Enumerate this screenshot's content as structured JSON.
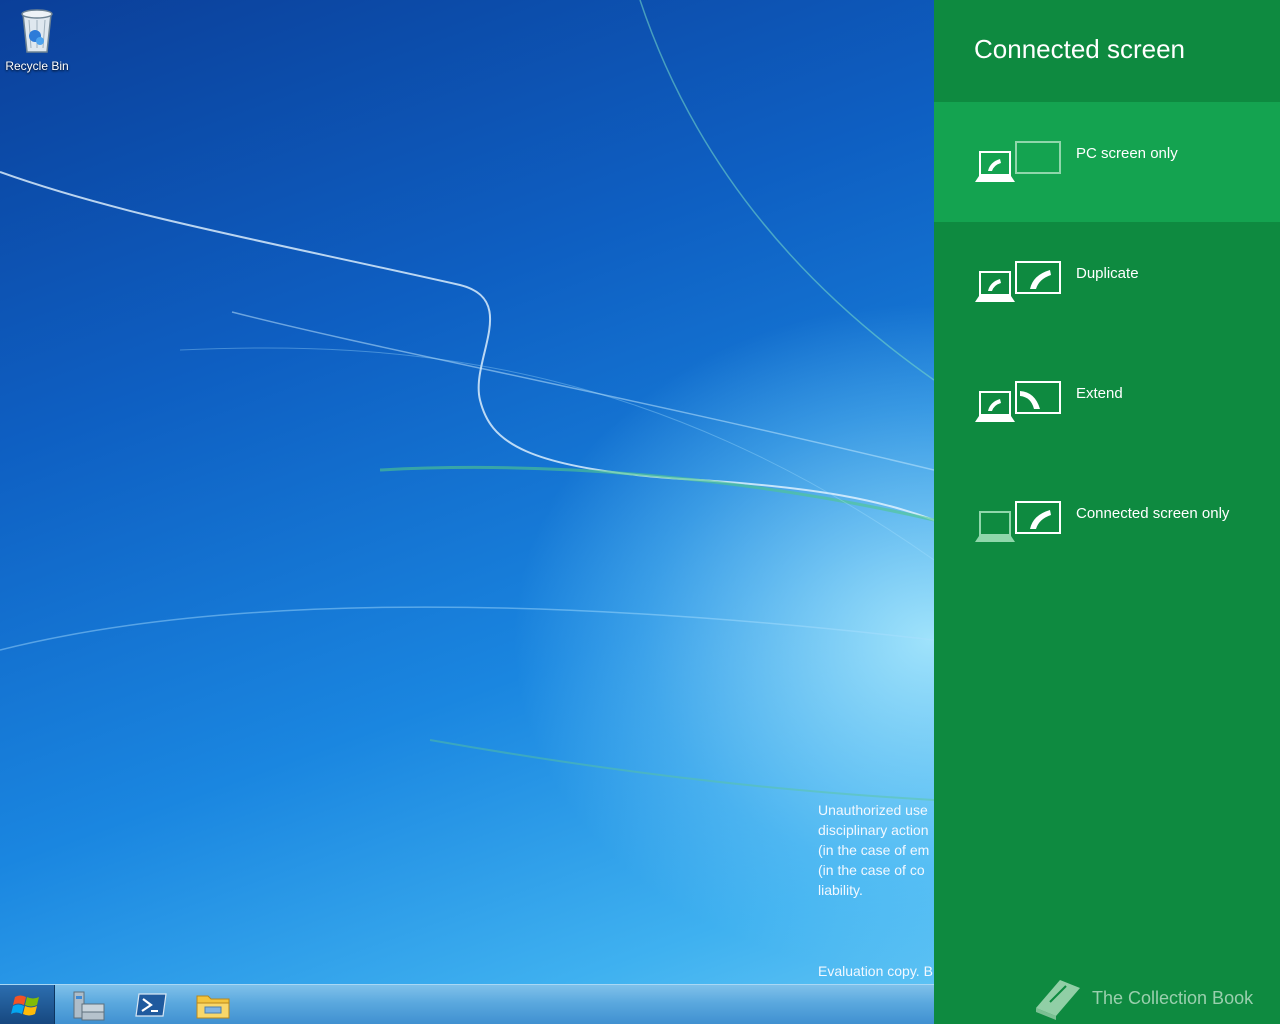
{
  "desktop": {
    "recycle_bin_label": "Recycle Bin",
    "legal_lines": [
      "Unauthorized use",
      "disciplinary action",
      "(in the case of em",
      "(in the case of co",
      "liability."
    ],
    "evaluation_text": "Evaluation copy. B"
  },
  "taskbar": {
    "items": [
      {
        "icon": "windows-logo-icon"
      },
      {
        "icon": "server-manager-icon"
      },
      {
        "icon": "powershell-icon"
      },
      {
        "icon": "file-explorer-icon"
      }
    ]
  },
  "charm": {
    "title": "Connected screen",
    "background": "#0e8a40",
    "selected_background": "#14a350",
    "options": [
      {
        "label": "PC screen only",
        "icon": "pc-screen-only-icon",
        "selected": true
      },
      {
        "label": "Duplicate",
        "icon": "duplicate-icon",
        "selected": false
      },
      {
        "label": "Extend",
        "icon": "extend-icon",
        "selected": false
      },
      {
        "label": "Connected screen only",
        "icon": "connected-screen-only-icon",
        "selected": false
      }
    ]
  },
  "watermark": {
    "text": "The Collection Book"
  }
}
